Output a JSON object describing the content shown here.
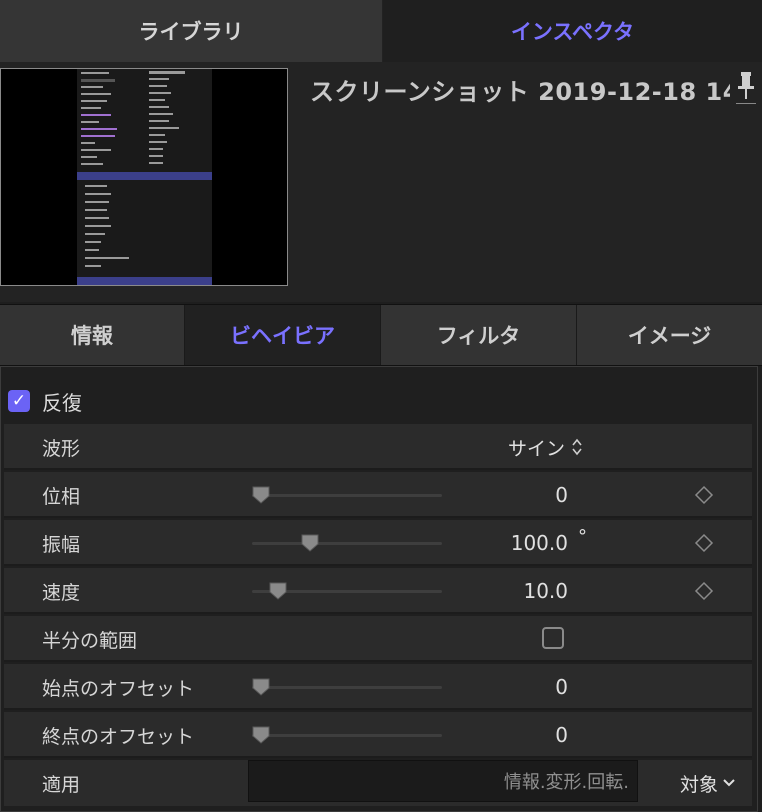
{
  "tabs": {
    "library": "ライブラリ",
    "inspector": "インスペクタ"
  },
  "header": {
    "title": "スクリーンショット 2019-12-18 14"
  },
  "subtabs": {
    "info": "情報",
    "behavior": "ビヘイビア",
    "filter": "フィルタ",
    "image": "イメージ"
  },
  "section": {
    "title": "反復",
    "checked": true
  },
  "rows": {
    "waveform": {
      "label": "波形",
      "value": "サイン"
    },
    "phase": {
      "label": "位相",
      "value": "0",
      "slider": 0.0
    },
    "amplitude": {
      "label": "振幅",
      "value": "100.0",
      "unit": "°",
      "slider": 0.26
    },
    "speed": {
      "label": "速度",
      "value": "10.0",
      "slider": 0.09
    },
    "half_range": {
      "label": "半分の範囲",
      "checked": false
    },
    "start_offset": {
      "label": "始点のオフセット",
      "value": "0",
      "slider": 0.0
    },
    "end_offset": {
      "label": "終点のオフセット",
      "value": "0",
      "slider": 0.0
    },
    "apply": {
      "label": "適用",
      "placeholder": "情報.変形.回転.",
      "target": "対象"
    }
  },
  "colors": {
    "accent": "#7a71ff",
    "checkbox": "#6b63f5"
  }
}
